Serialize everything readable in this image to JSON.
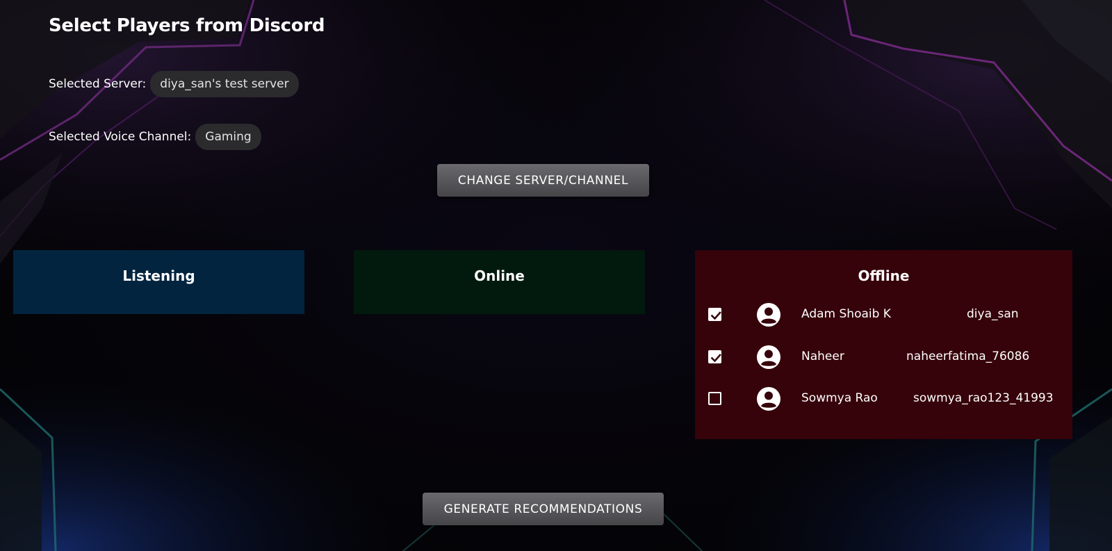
{
  "header": {
    "title": "Select Players from Discord"
  },
  "selection": {
    "server_label": "Selected Server:",
    "server_value": "diya_san's test server",
    "channel_label": "Selected Voice Channel:",
    "channel_value": "Gaming"
  },
  "buttons": {
    "change": "CHANGE SERVER/CHANNEL",
    "generate": "GENERATE RECOMMENDATIONS"
  },
  "panels": {
    "listening": {
      "title": "Listening",
      "color": "#02243f"
    },
    "online": {
      "title": "Online",
      "color": "#021a0e"
    },
    "offline": {
      "title": "Offline",
      "color": "#36030a",
      "players": [
        {
          "name": "Adam Shoaib K",
          "username": "diya_san",
          "checked": true,
          "icon": "user-avatar-icon"
        },
        {
          "name": "Naheer",
          "username": "naheerfatima_76086",
          "checked": true,
          "icon": "user-avatar-icon"
        },
        {
          "name": "Sowmya Rao",
          "username": "sowmya_rao123_41993",
          "checked": false,
          "icon": "user-avatar-icon"
        }
      ]
    }
  }
}
